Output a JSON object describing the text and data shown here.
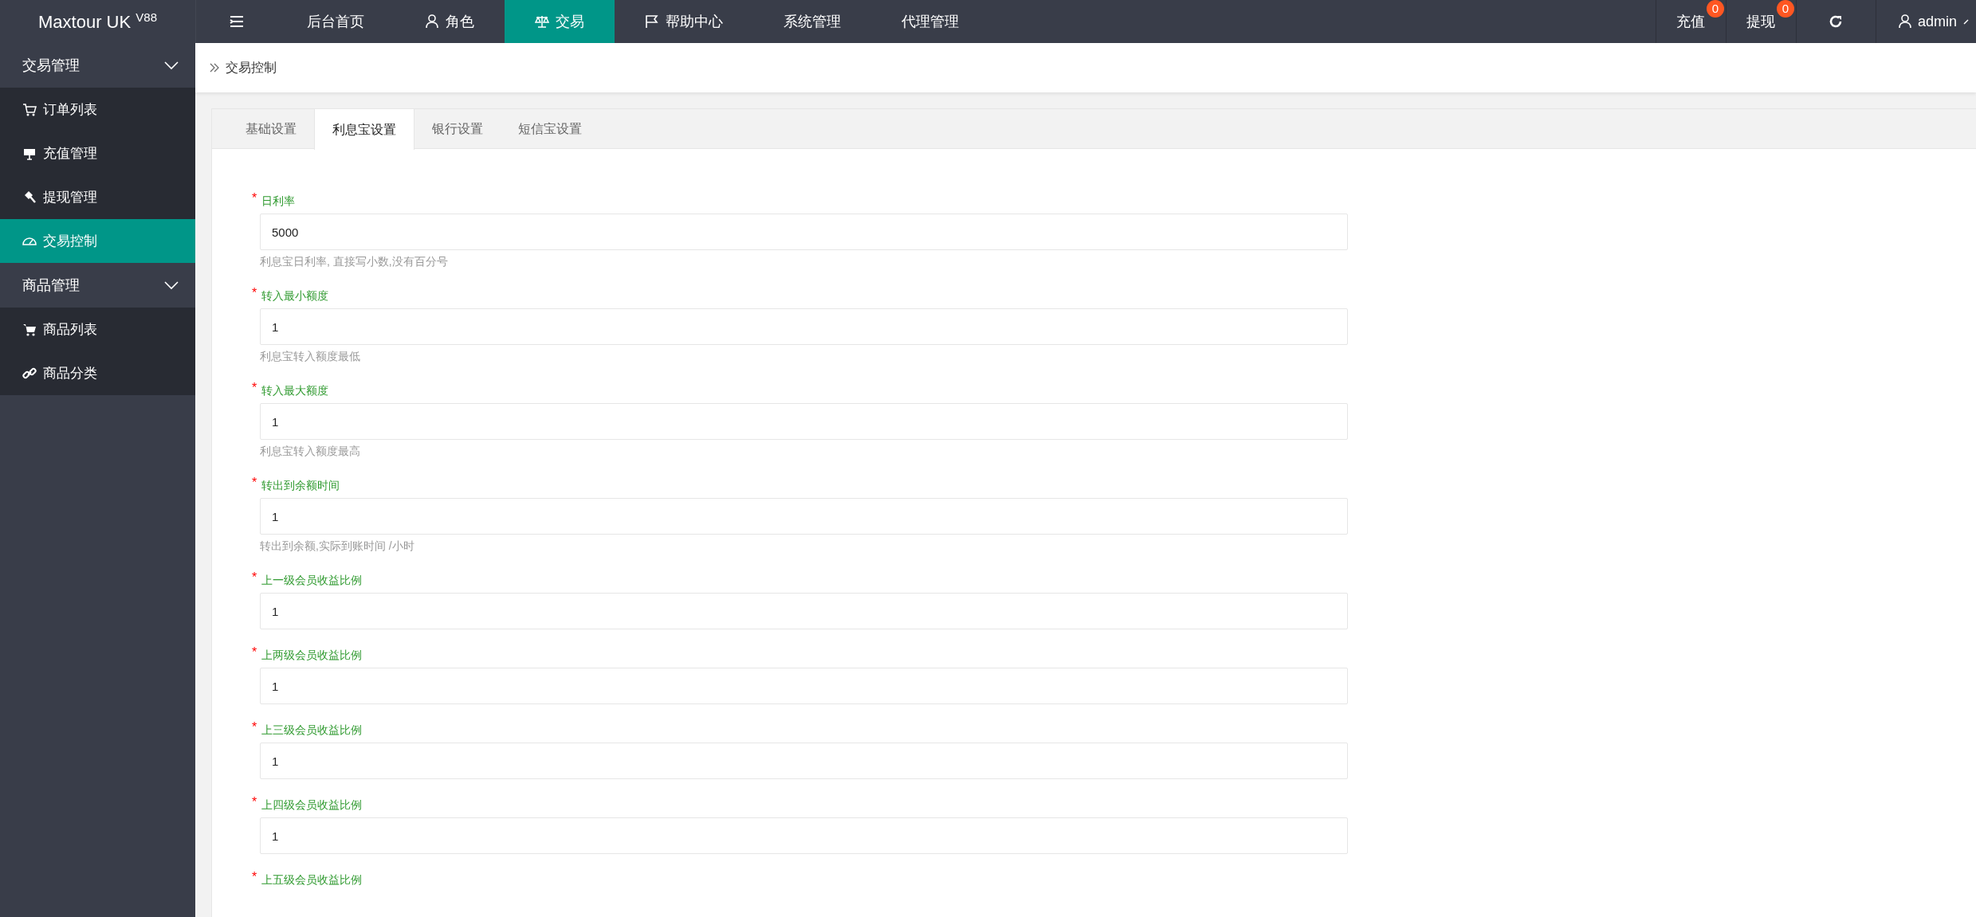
{
  "brand": {
    "name": "Maxtour UK",
    "version": "V88"
  },
  "nav_items": [
    {
      "label": "后台首页",
      "selected": false
    },
    {
      "label": "角色",
      "selected": false
    },
    {
      "label": "交易",
      "selected": true
    },
    {
      "label": "帮助中心",
      "selected": false
    },
    {
      "label": "系统管理",
      "selected": false
    },
    {
      "label": "代理管理",
      "selected": false
    }
  ],
  "top_right": [
    {
      "label": "充值",
      "badge": "0"
    },
    {
      "label": "提现",
      "badge": "0"
    }
  ],
  "user": {
    "name": "admin"
  },
  "sidebar": [
    {
      "label": "交易管理",
      "expanded": true,
      "children": [
        {
          "label": "订单列表",
          "selected": false
        },
        {
          "label": "充值管理",
          "selected": false
        },
        {
          "label": "提现管理",
          "selected": false
        },
        {
          "label": "交易控制",
          "selected": true
        }
      ]
    },
    {
      "label": "商品管理",
      "expanded": true,
      "children": [
        {
          "label": "商品列表",
          "selected": false
        },
        {
          "label": "商品分类",
          "selected": false
        }
      ]
    }
  ],
  "breadcrumb": "交易控制",
  "tabs": [
    {
      "label": "基础设置",
      "selected": false
    },
    {
      "label": "利息宝设置",
      "selected": true
    },
    {
      "label": "银行设置",
      "selected": false
    },
    {
      "label": "短信宝设置",
      "selected": false
    }
  ],
  "fields": [
    {
      "mark": "*",
      "label": "日利率",
      "value": "5000",
      "hint": "利息宝日利率, 直接写小数,没有百分号"
    },
    {
      "mark": "*",
      "label": "转入最小额度",
      "value": "1",
      "hint": "利息宝转入额度最低"
    },
    {
      "mark": "*",
      "label": "转入最大额度",
      "value": "1",
      "hint": "利息宝转入额度最高"
    },
    {
      "mark": "*",
      "label": "转出到余额时间",
      "value": "1",
      "hint": "转出到余额,实际到账时间 /小时"
    },
    {
      "mark": "*",
      "label": "上一级会员收益比例",
      "value": "1"
    },
    {
      "mark": "*",
      "label": "上两级会员收益比例",
      "value": "1"
    },
    {
      "mark": "*",
      "label": "上三级会员收益比例",
      "value": "1"
    },
    {
      "mark": "*",
      "label": "上四级会员收益比例",
      "value": "1"
    },
    {
      "mark": "*",
      "label": "上五级会员收益比例"
    }
  ]
}
